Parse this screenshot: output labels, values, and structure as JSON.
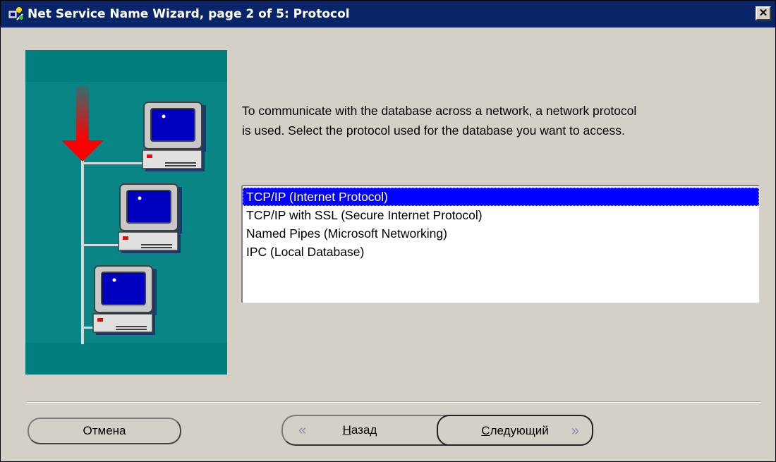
{
  "window": {
    "title": "Net Service Name Wizard, page 2 of 5: Protocol",
    "close_glyph": "✕"
  },
  "instructions": {
    "line1": "To communicate with the database across a network, a network protocol",
    "line2": "is used.  Select the protocol used for the database you want to access."
  },
  "protocols": {
    "items": [
      "TCP/IP (Internet Protocol)",
      "TCP/IP with SSL (Secure Internet Protocol)",
      "Named Pipes (Microsoft Networking)",
      "IPC (Local Database)"
    ],
    "selected_index": 0
  },
  "buttons": {
    "cancel": "Отмена",
    "back_first": "Н",
    "back_rest": "азад",
    "next_first": "С",
    "next_rest": "ледующий",
    "back_arrow": "«",
    "next_arrow": "»"
  },
  "colors": {
    "titlebar": "#0a246a",
    "illustration_bg": "#007f7f",
    "selection": "#0000ff",
    "arrow": "#ff0000"
  },
  "icons": {
    "app": "wizard-app-icon",
    "illustration": "network-computers-illustration"
  }
}
